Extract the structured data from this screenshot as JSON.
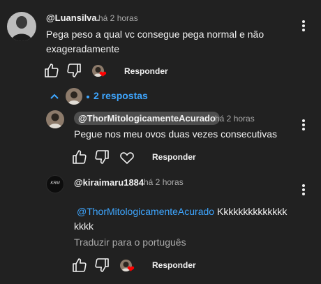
{
  "comment": {
    "author": "@Luansilva.",
    "time": "há 2 horas",
    "text_line1": "Pega peso a qual vc consegue pega normal e não",
    "text_line2": "exageradamente",
    "reply_label": "Responder"
  },
  "replies_toggle": {
    "label": "2 respostas"
  },
  "reply1": {
    "author": "@ThorMitologicamenteAcurado",
    "time": "há 2 horas",
    "text": "Pegue nos meu ovos duas vezes consecutivas",
    "reply_label": "Responder"
  },
  "reply2": {
    "author": "@kiraimaru1884",
    "time": "há 2 horas",
    "mention": "@ThorMitologicamenteAcurado",
    "text_rest": " Kkkkkkkkkkkkkk",
    "text_line2": "kkkk",
    "translate_label": "Traduzir para o português",
    "reply_label": "Responder",
    "avatar_text": "KRM"
  },
  "colors": {
    "background": "#212121",
    "link": "#3ea6ff",
    "heart": "#ff0000",
    "secondary_text": "#aaaaaa"
  },
  "icons": [
    "like-icon",
    "dislike-icon",
    "heart-icon",
    "more-vert-icon",
    "chevron-up-icon"
  ]
}
